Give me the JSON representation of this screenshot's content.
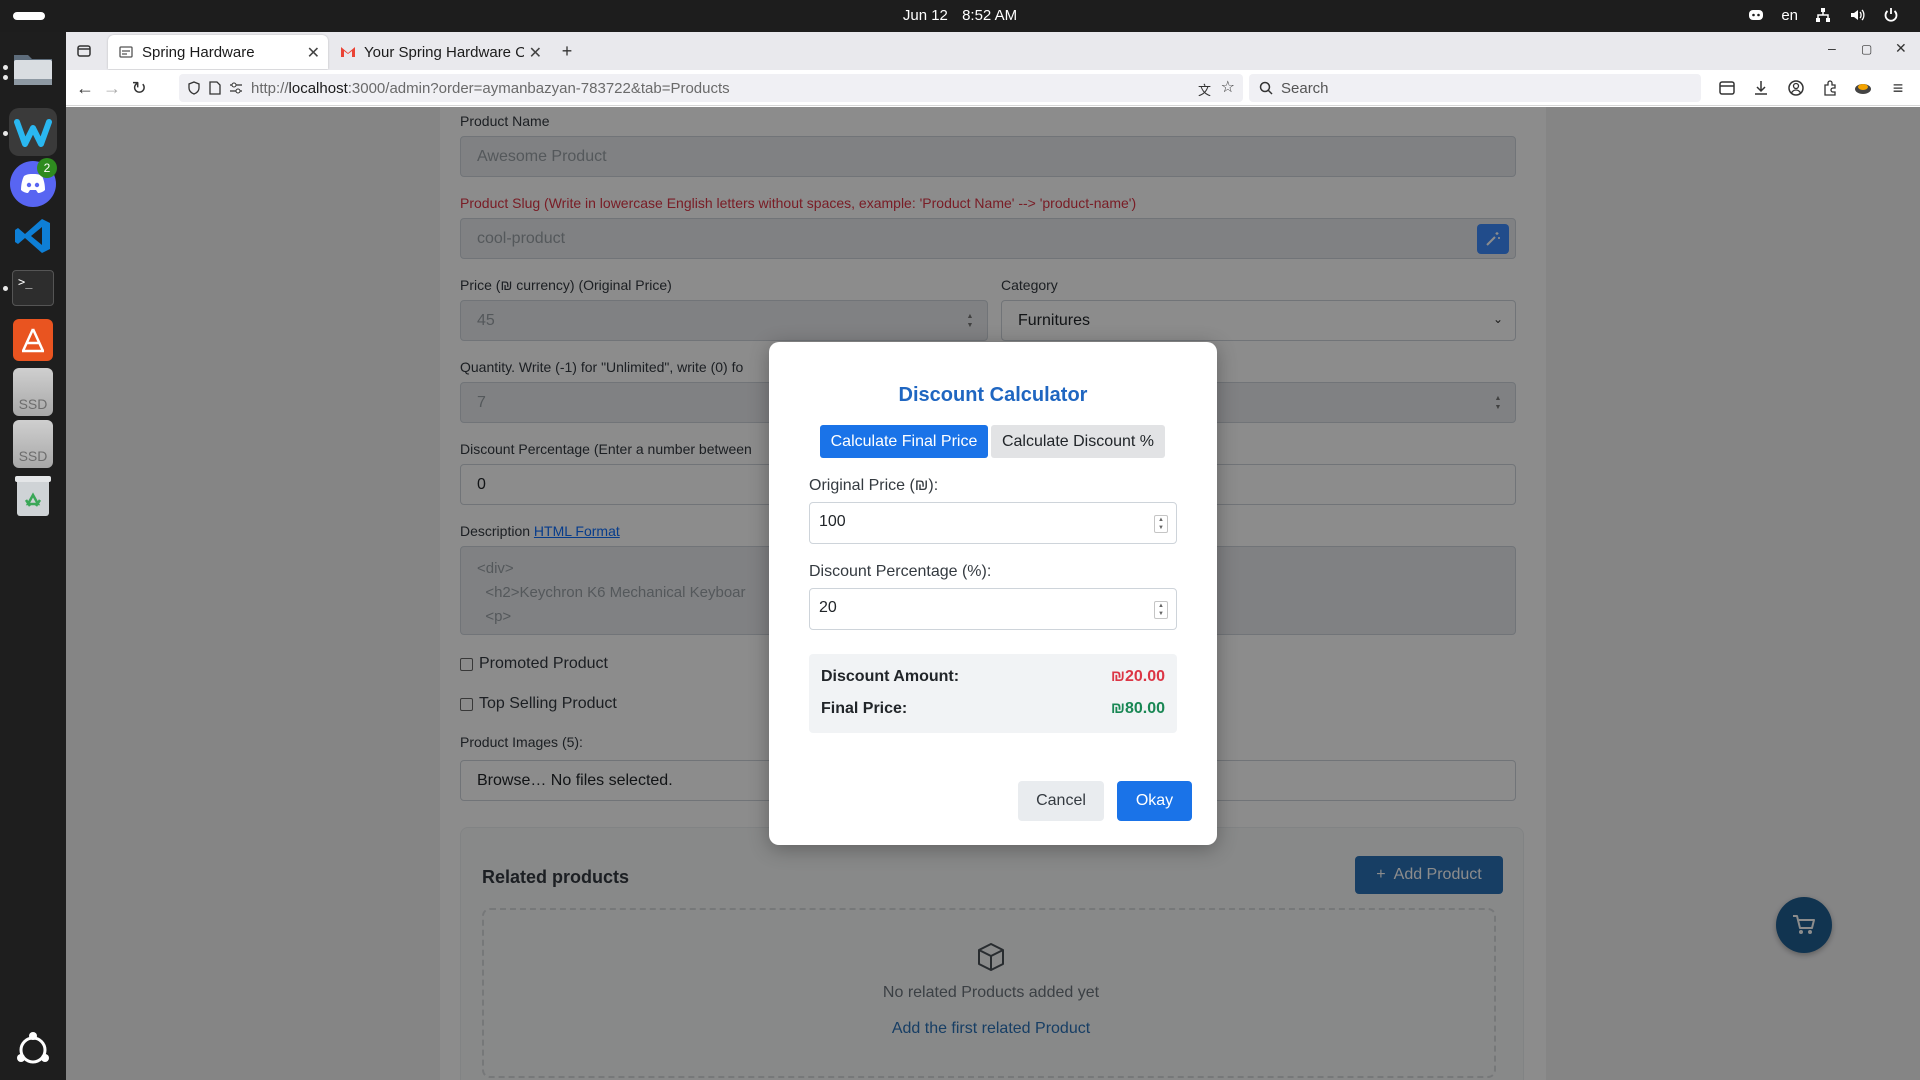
{
  "topbar": {
    "date": "Jun 12",
    "time": "8:52 AM",
    "lang": "en"
  },
  "dock": {
    "discord_badge": "2",
    "ssd1_label": "SSD",
    "ssd2_label": "SSD"
  },
  "browser": {
    "tabs": [
      {
        "title": "Spring Hardware"
      },
      {
        "title": "Your Spring Hardware Or"
      }
    ],
    "url_prefix": "http://",
    "url_host": "localhost",
    "url_rest": ":3000/admin?order=aymanbazyan-783722&tab=Products",
    "search_placeholder": "Search"
  },
  "form": {
    "product_name_label": "Product Name",
    "product_name_placeholder": "Awesome Product",
    "slug_label": "Product Slug (Write in lowercase English letters without spaces, example: 'Product Name' --> 'product-name')",
    "slug_placeholder": "cool-product",
    "price_label": "Price (₪ currency) (Original Price)",
    "price_value": "45",
    "category_label": "Category",
    "category_value": "Furnitures",
    "quantity_label": "Quantity. Write (-1) for \"Unlimited\", write (0) fo",
    "quantity_value": "7",
    "discount_label": "Discount Percentage (Enter a number between",
    "discount_value": "0",
    "description_label": "Description",
    "description_link": "HTML Format",
    "description_lines": [
      "<div>",
      "  <h2>Keychron K6 Mechanical Keyboar",
      "  <p>"
    ],
    "promoted_label": "Promoted Product",
    "top_selling_label": "Top Selling Product",
    "images_label": "Product Images (5):",
    "file_input_text": "Browse… No files selected."
  },
  "related": {
    "title": "Related products",
    "add_button": "Add Product",
    "empty_text": "No related Products added yet",
    "empty_link": "Add the first related Product"
  },
  "modal": {
    "title": "Discount Calculator",
    "tab_final": "Calculate Final Price",
    "tab_discount": "Calculate Discount %",
    "original_price_label": "Original Price (₪):",
    "original_price_value": "100",
    "discount_pct_label": "Discount Percentage (%):",
    "discount_pct_value": "20",
    "discount_amount_label": "Discount Amount:",
    "discount_amount_value": "₪20.00",
    "final_price_label": "Final Price:",
    "final_price_value": "₪80.00",
    "cancel": "Cancel",
    "okay": "Okay"
  },
  "colors": {
    "accent": "#1a73e8",
    "danger": "#dc3545",
    "success": "#198754",
    "brand_dark": "#2a71b7"
  }
}
